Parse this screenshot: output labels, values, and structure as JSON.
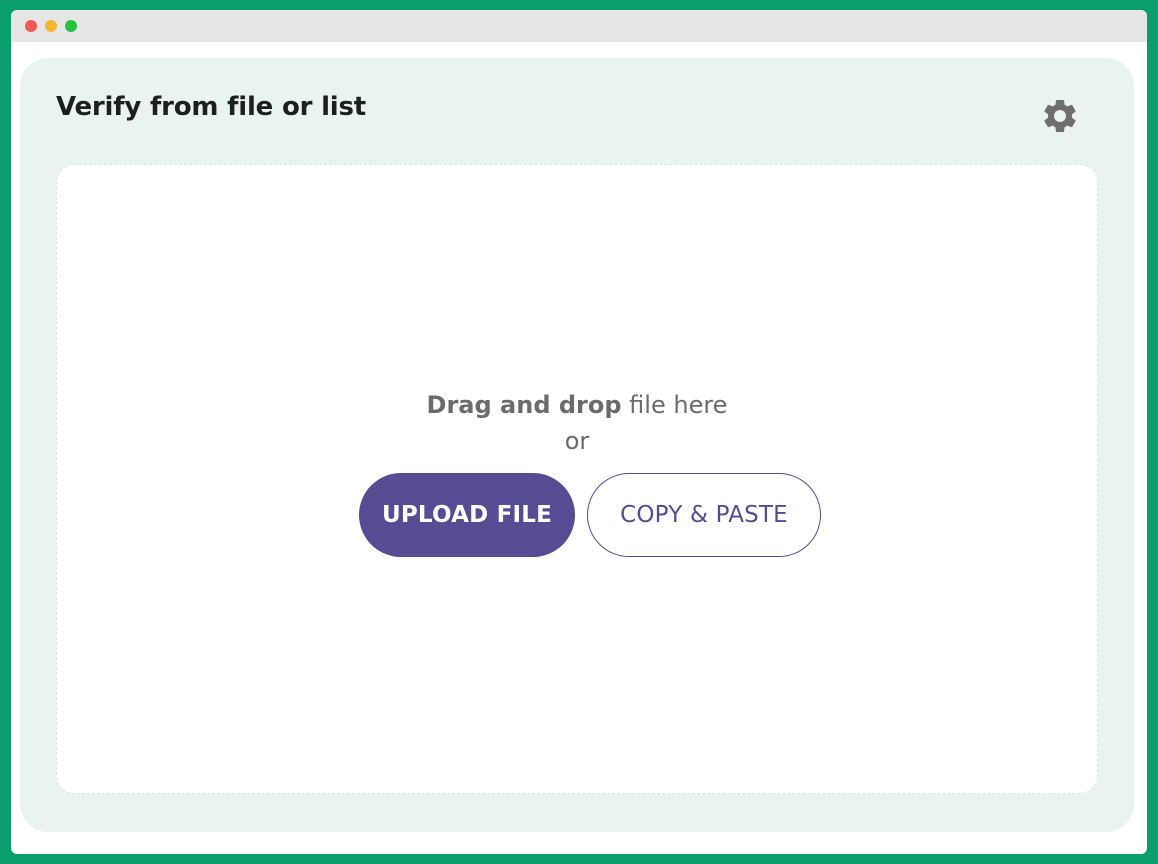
{
  "window": {
    "controls": [
      "close-dot",
      "minimize-dot",
      "maximize-dot"
    ]
  },
  "panel": {
    "title": "Verify from file or list",
    "settings_icon": "gear-icon"
  },
  "dropzone": {
    "drag_bold": "Drag and drop",
    "drag_rest": " file here",
    "or_text": "or",
    "upload_label": "UPLOAD FILE",
    "paste_label": "COPY & PASTE"
  },
  "colors": {
    "background": "#0a9e6a",
    "panel": "#e9f4f0",
    "accent": "#554c93"
  }
}
